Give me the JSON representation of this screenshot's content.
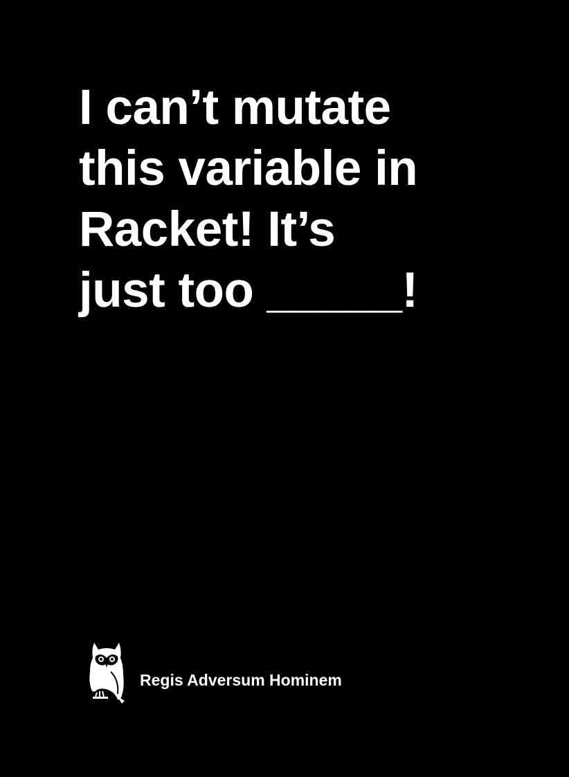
{
  "card": {
    "prompt_lines": [
      "I can’t mutate",
      "this variable in",
      "Racket! It’s",
      "just too _____!"
    ],
    "footer": {
      "icon": "owl-icon",
      "brand": "Regis Adversum Hominem"
    },
    "colors": {
      "background": "#000000",
      "text": "#ffffff"
    }
  }
}
